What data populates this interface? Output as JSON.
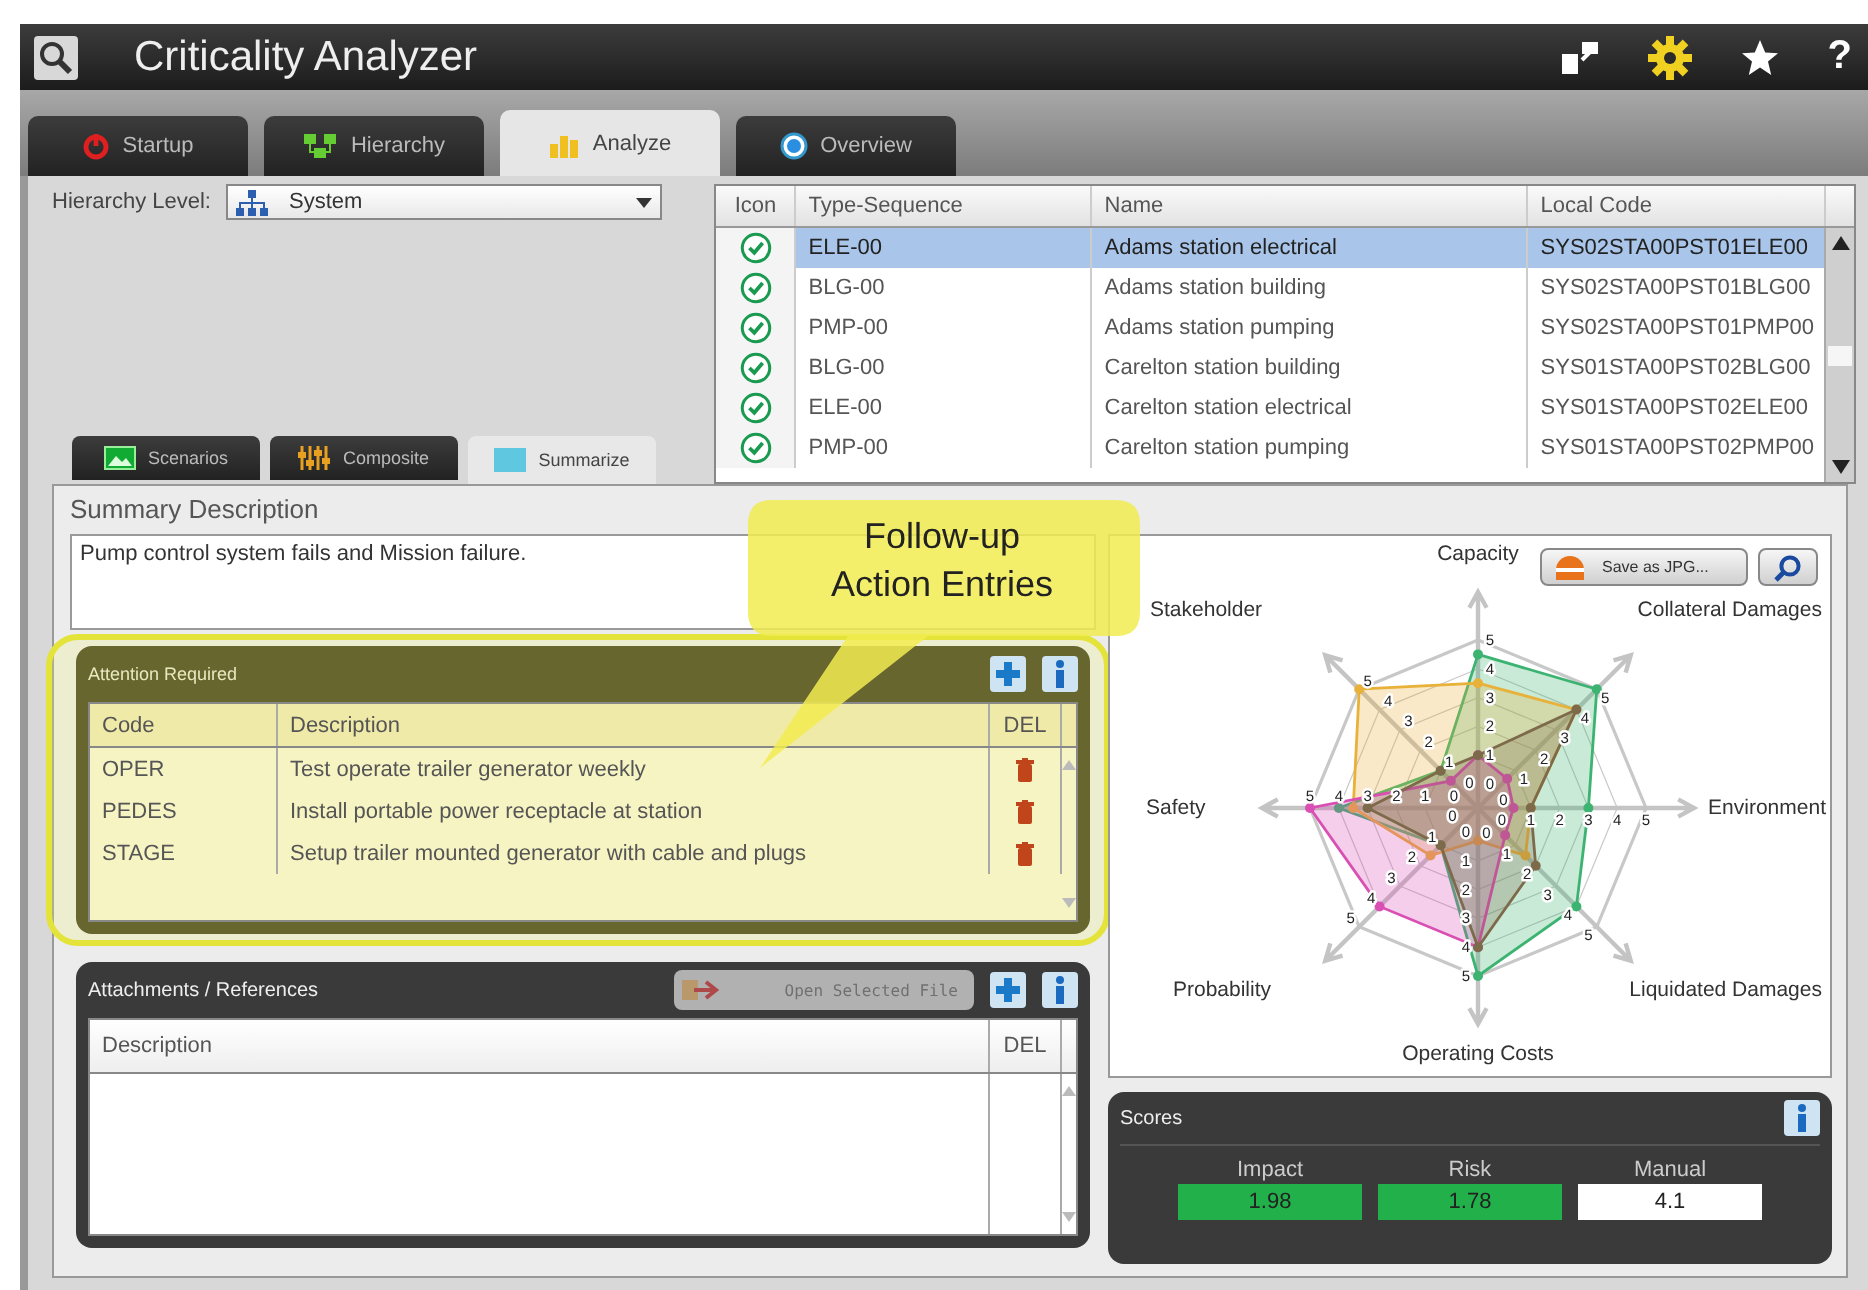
{
  "window": {
    "title": "Criticality Analyzer",
    "help": "?"
  },
  "tabs": [
    {
      "label": "Startup",
      "selected": false
    },
    {
      "label": "Hierarchy",
      "selected": false
    },
    {
      "label": "Analyze",
      "selected": true
    },
    {
      "label": "Overview",
      "selected": false
    }
  ],
  "hierarchy_level": {
    "label": "Hierarchy Level:",
    "value": "System"
  },
  "table": {
    "columns": [
      "Icon",
      "Type-Sequence",
      "Name",
      "Local Code"
    ],
    "rows": [
      {
        "selected": true,
        "cells": [
          "",
          "ELE-00",
          "Adams station electrical",
          "SYS02STA00PST01ELE00"
        ]
      },
      {
        "selected": false,
        "cells": [
          "",
          "BLG-00",
          "Adams station building",
          "SYS02STA00PST01BLG00"
        ]
      },
      {
        "selected": false,
        "cells": [
          "",
          "PMP-00",
          "Adams station pumping",
          "SYS02STA00PST01PMP00"
        ]
      },
      {
        "selected": false,
        "cells": [
          "",
          "BLG-00",
          "Carelton station building",
          "SYS01STA00PST02BLG00"
        ]
      },
      {
        "selected": false,
        "cells": [
          "",
          "ELE-00",
          "Carelton station electrical",
          "SYS01STA00PST02ELE00"
        ]
      },
      {
        "selected": false,
        "cells": [
          "",
          "PMP-00",
          "Carelton station pumping",
          "SYS01STA00PST02PMP00"
        ]
      }
    ]
  },
  "sub_tabs": [
    {
      "label": "Scenarios",
      "selected": false
    },
    {
      "label": "Composite",
      "selected": false
    },
    {
      "label": "Summarize",
      "selected": true
    }
  ],
  "summary": {
    "title": "Summary Description",
    "text": "Pump control system fails and Mission failure."
  },
  "attention": {
    "title": "Attention Required",
    "columns": [
      "Code",
      "Description",
      "DEL"
    ],
    "rows": [
      {
        "code": "OPER",
        "description": "Test operate trailer generator weekly"
      },
      {
        "code": "PEDES",
        "description": "Install portable power receptacle at station"
      },
      {
        "code": "STAGE",
        "description": "Setup trailer mounted generator with cable and plugs"
      }
    ]
  },
  "attachments": {
    "title": "Attachments / References",
    "open_button": {
      "label": "Open Selected File",
      "disabled": true
    },
    "columns": [
      "Description",
      "DEL"
    ]
  },
  "chart": {
    "save_button": "Save as JPG...",
    "axes": [
      {
        "label": "Capacity",
        "ticks": [
          "5",
          "4",
          "3",
          "2",
          "1",
          "0"
        ]
      },
      {
        "label": "Stakeholder",
        "ticks": [
          "5",
          "4",
          "3",
          "2",
          "1",
          "0"
        ]
      },
      {
        "label": "Collateral Damages",
        "ticks": [
          "5",
          "4",
          "3",
          "2",
          "1",
          "0"
        ]
      },
      {
        "label": "Safety",
        "ticks": [
          "5",
          "4",
          "3",
          "2",
          "1",
          "0"
        ]
      },
      {
        "label": "Environment",
        "ticks": [
          "0",
          "1",
          "2",
          "3",
          "4",
          "5"
        ]
      },
      {
        "label": "Probability",
        "ticks": [
          "0",
          "1",
          "2",
          "3",
          "4",
          "5"
        ]
      },
      {
        "label": "Liquidated Damages",
        "ticks": [
          "0",
          "1",
          "2",
          "3",
          "4",
          "5"
        ]
      },
      {
        "label": "Operating Costs",
        "ticks": [
          "0",
          "1",
          "2",
          "3",
          "4",
          "5"
        ]
      }
    ]
  },
  "scores": {
    "title": "Scores",
    "items": [
      {
        "label": "Impact",
        "value": "1.98",
        "color": "#22b04a"
      },
      {
        "label": "Risk",
        "value": "1.78",
        "color": "#22b04a"
      },
      {
        "label": "Manual",
        "value": "4.1",
        "color": "#ffffff"
      }
    ]
  },
  "callout": {
    "lines": [
      "Follow-up",
      "Action Entries"
    ]
  }
}
